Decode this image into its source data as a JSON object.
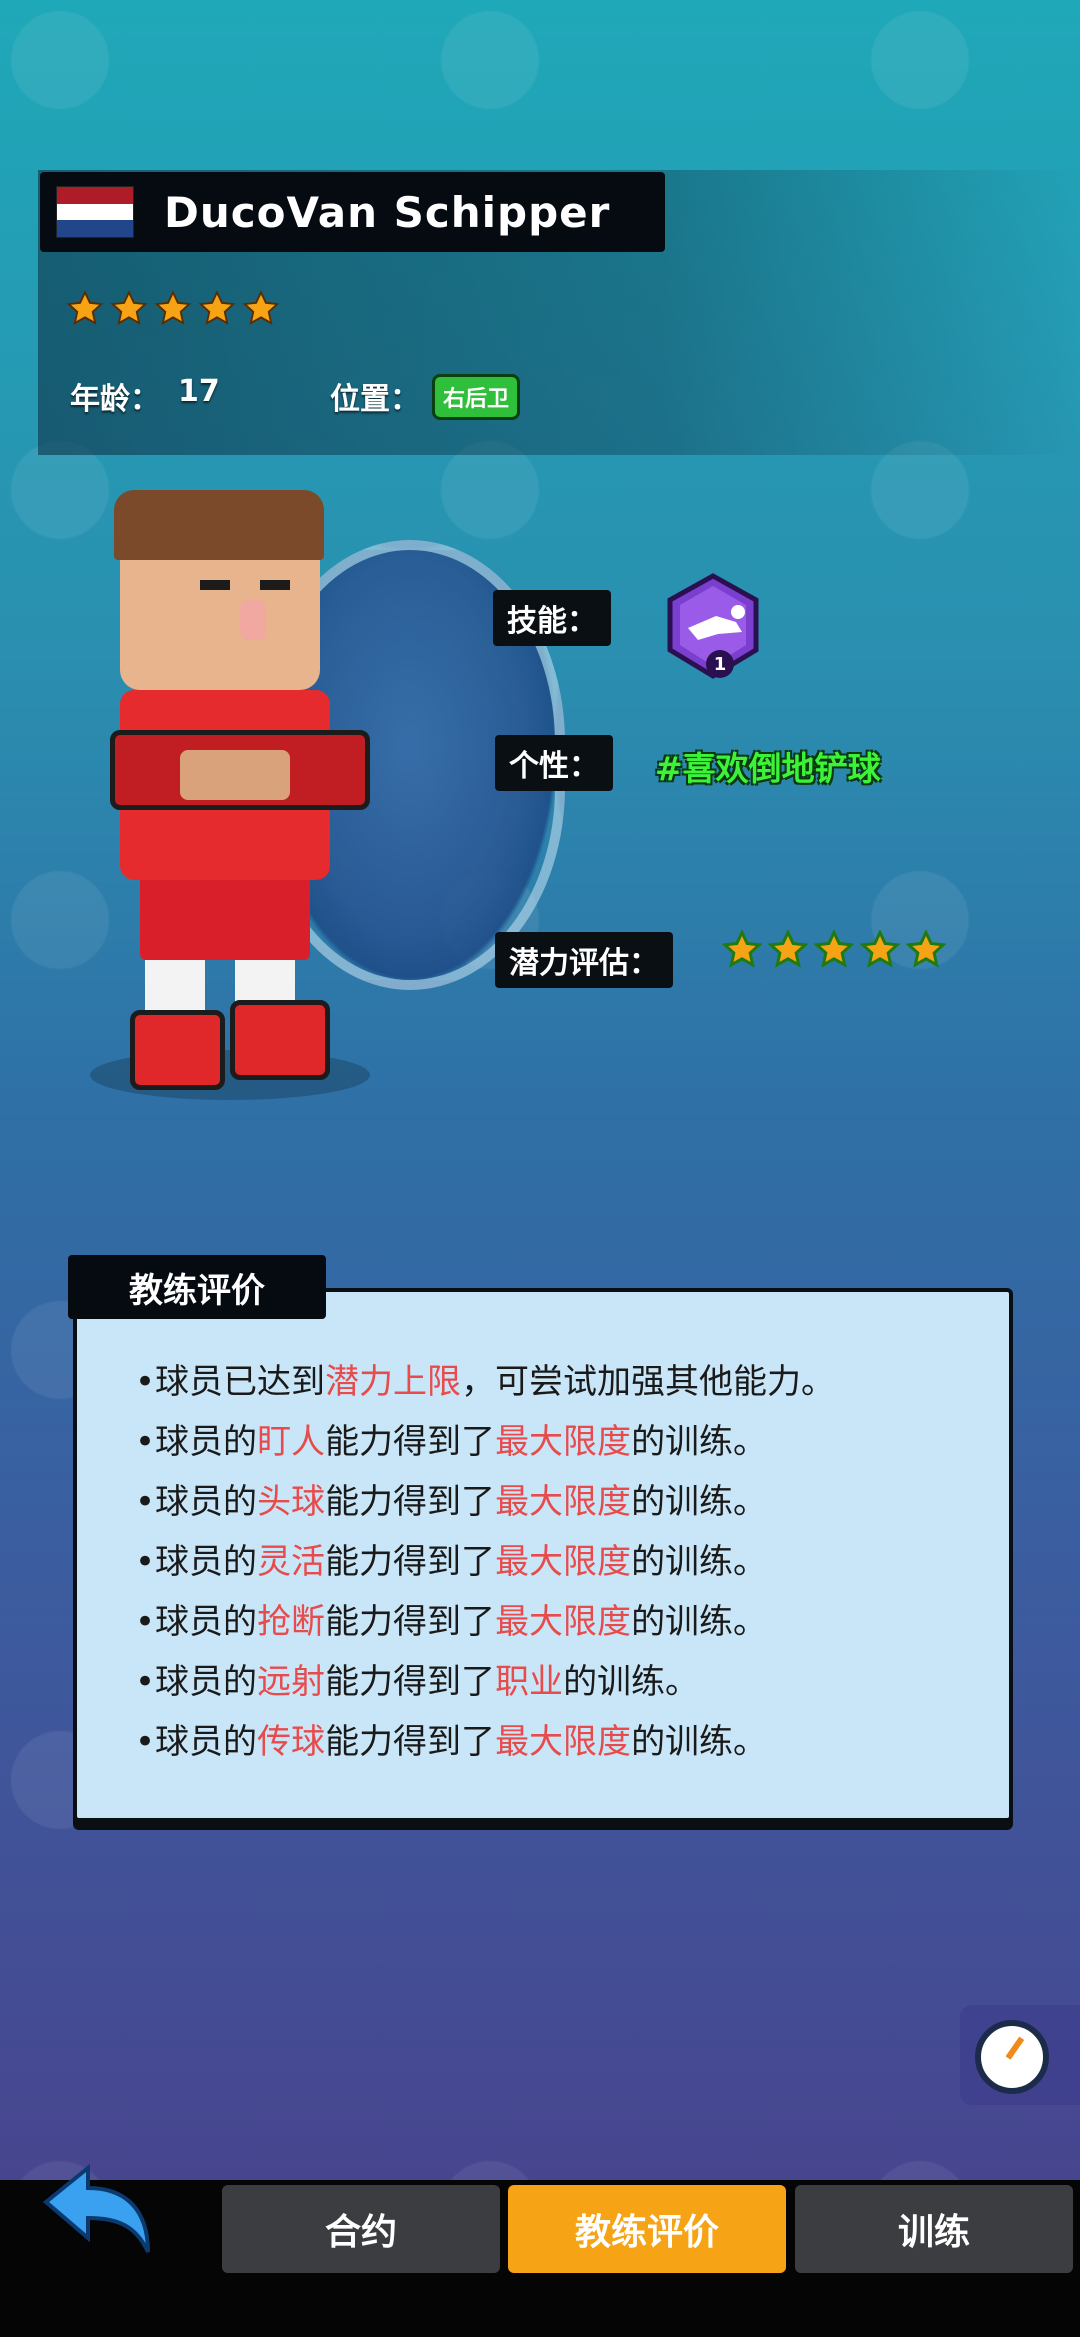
{
  "player": {
    "name": "DucoVan Schipper",
    "flag_colors": [
      "#ae1c28",
      "#ffffff",
      "#21468b"
    ],
    "rating_stars": 5,
    "age_label": "年龄：",
    "age_value": "17",
    "position_label": "位置：",
    "position_value": "右后卫"
  },
  "details": {
    "skill_label": "技能：",
    "skill_level": "1",
    "trait_label": "个性：",
    "trait_value": "#喜欢倒地铲球",
    "potential_label": "潜力评估：",
    "potential_stars": 5
  },
  "coach": {
    "title": "教练评价",
    "lines": [
      {
        "pre": "•球员已达到",
        "hl": "潜力上限",
        "mid": "，可尝试加强其他能力。",
        "hl2": "",
        "post": ""
      },
      {
        "pre": "•球员的",
        "hl": "盯人",
        "mid": "能力得到了",
        "hl2": "最大限度",
        "post": "的训练。"
      },
      {
        "pre": "•球员的",
        "hl": "头球",
        "mid": "能力得到了",
        "hl2": "最大限度",
        "post": "的训练。"
      },
      {
        "pre": "•球员的",
        "hl": "灵活",
        "mid": "能力得到了",
        "hl2": "最大限度",
        "post": "的训练。"
      },
      {
        "pre": "•球员的",
        "hl": "抢断",
        "mid": "能力得到了",
        "hl2": "最大限度",
        "post": "的训练。"
      },
      {
        "pre": "•球员的",
        "hl": "远射",
        "mid": "能力得到了",
        "hl2": "职业",
        "post": "的训练。"
      },
      {
        "pre": "•球员的",
        "hl": "传球",
        "mid": "能力得到了",
        "hl2": "最大限度",
        "post": "的训练。"
      }
    ]
  },
  "tabs": {
    "contract": "合约",
    "coach_eval": "教练评价",
    "training": "训练"
  },
  "icons": {
    "back": "back-arrow-icon",
    "stopwatch": "stopwatch-icon",
    "skill": "slide-tackle-skill-icon"
  },
  "colors": {
    "star": "#f6a316",
    "potential_star": "#f6a316",
    "highlight": "#e84b4b",
    "active_tab": "#f6a316",
    "trait_green": "#3ef23a"
  }
}
